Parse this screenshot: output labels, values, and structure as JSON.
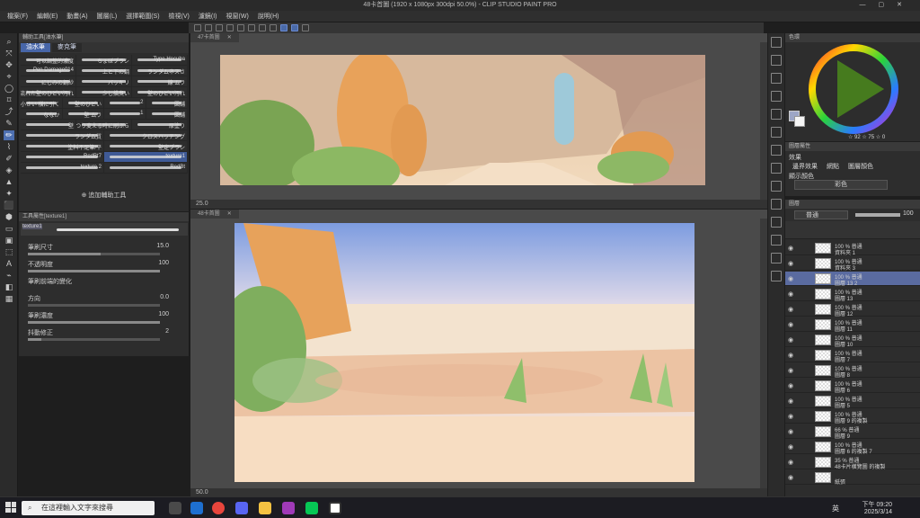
{
  "window": {
    "title": "48卡首圖 (1920 x 1080px 300dpi 50.0%) - CLIP STUDIO PAINT PRO"
  },
  "menu": [
    "檔案(F)",
    "編輯(E)",
    "動畫(A)",
    "圖層(L)",
    "選擇範圍(S)",
    "檢視(V)",
    "濾鏡(I)",
    "視窗(W)",
    "說明(H)"
  ],
  "subtool": {
    "header": "輔助工具[油水筆]",
    "tabs": [
      "油水筆",
      "麥克筆"
    ],
    "brushes": [
      [
        "可以調整的濃度",
        "ちょぼブラシ",
        "Type Hecuba"
      ],
      [
        "Pen Damage014",
        "上と下の鋼",
        "ランダムネスさ"
      ],
      [
        "にじみの鋼紗",
        "バッキリ",
        "線 ムラ"
      ],
      [
        "流れた壁のひどい汚れ",
        "少し描臭い",
        "壁のひどい汚れ"
      ],
      [
        "小さい 横に引く",
        "壁のひどい",
        "2",
        "圓鋪"
      ],
      [
        "ななか",
        "壁 ムラ",
        "1",
        "圓鋪"
      ],
      [
        "壁",
        "ムラ色がつり変える時に刷ぶら",
        "厚塗り"
      ],
      [
        "ランダム質",
        "クロスハッチング"
      ],
      [
        "塗料不足筆/平",
        "壁定ブラシ"
      ],
      [
        "RedBt7",
        "texture1"
      ],
      [
        "texture 2",
        "RedBt"
      ]
    ],
    "add_tool": "追加輔助工具"
  },
  "toolprop": {
    "header": "工具屬性[texture1]",
    "brush_name": "texture1",
    "rows": [
      {
        "label": "筆刷尺寸",
        "value": "15.0",
        "level": 0.55
      },
      {
        "label": "不透明度",
        "value": "100",
        "level": 1.0
      },
      {
        "label": "筆刷前端的變化",
        "value": "",
        "level": null
      },
      {
        "label": "方向",
        "value": "0.0",
        "level": 0.0
      },
      {
        "label": "筆刷濃度",
        "value": "100",
        "level": 1.0
      },
      {
        "label": "抖動修正",
        "value": "2",
        "level": 0.1
      }
    ]
  },
  "canvas_top": {
    "tab": "47卡首圖",
    "zoom": "25.0"
  },
  "canvas_bottom": {
    "tab": "48卡首圖",
    "zoom": "50.0"
  },
  "color": {
    "header": "色環",
    "hsv": "☆ 92 ☆ 75 ☆ 0",
    "accent": "#6cbd2e"
  },
  "layer_opts": {
    "header": "圖層屬性",
    "effect": "效果",
    "options": [
      "邊界效果",
      "網點",
      "圖層顏色"
    ],
    "display": "顯示顏色",
    "color_mode": "彩色"
  },
  "layers": {
    "header": "圖層",
    "blend": "普通",
    "opacity": "100",
    "rows": [
      {
        "t1": "100 % 普通",
        "t2": "資料夾 1"
      },
      {
        "t1": "100 % 普通",
        "t2": "資料夾 3"
      },
      {
        "t1": "100 % 普通",
        "t2": "圖層 13 2"
      },
      {
        "t1": "100 % 普通",
        "t2": "圖層 13"
      },
      {
        "t1": "100 % 普通",
        "t2": "圖層 12"
      },
      {
        "t1": "100 % 普通",
        "t2": "圖層 11"
      },
      {
        "t1": "100 % 普通",
        "t2": "圖層 10"
      },
      {
        "t1": "100 % 普通",
        "t2": "圖層 7"
      },
      {
        "t1": "100 % 普通",
        "t2": "圖層 8"
      },
      {
        "t1": "100 % 普通",
        "t2": "圖層 6"
      },
      {
        "t1": "100 % 普通",
        "t2": "圖層 5"
      },
      {
        "t1": "100 % 普通",
        "t2": "圖層 9 的複製"
      },
      {
        "t1": "66 % 普通",
        "t2": "圖層 9"
      },
      {
        "t1": "100 % 普通",
        "t2": "圖層 6 的複製 7"
      },
      {
        "t1": "35 % 普通",
        "t2": "48卡片橫覽圖 的複製"
      },
      {
        "t1": "",
        "t2": "紙張"
      }
    ]
  },
  "taskbar": {
    "search": "在這裡輸入文字來搜尋",
    "time": "下午 09:20",
    "date": "2025/3/14",
    "ime": "英"
  }
}
